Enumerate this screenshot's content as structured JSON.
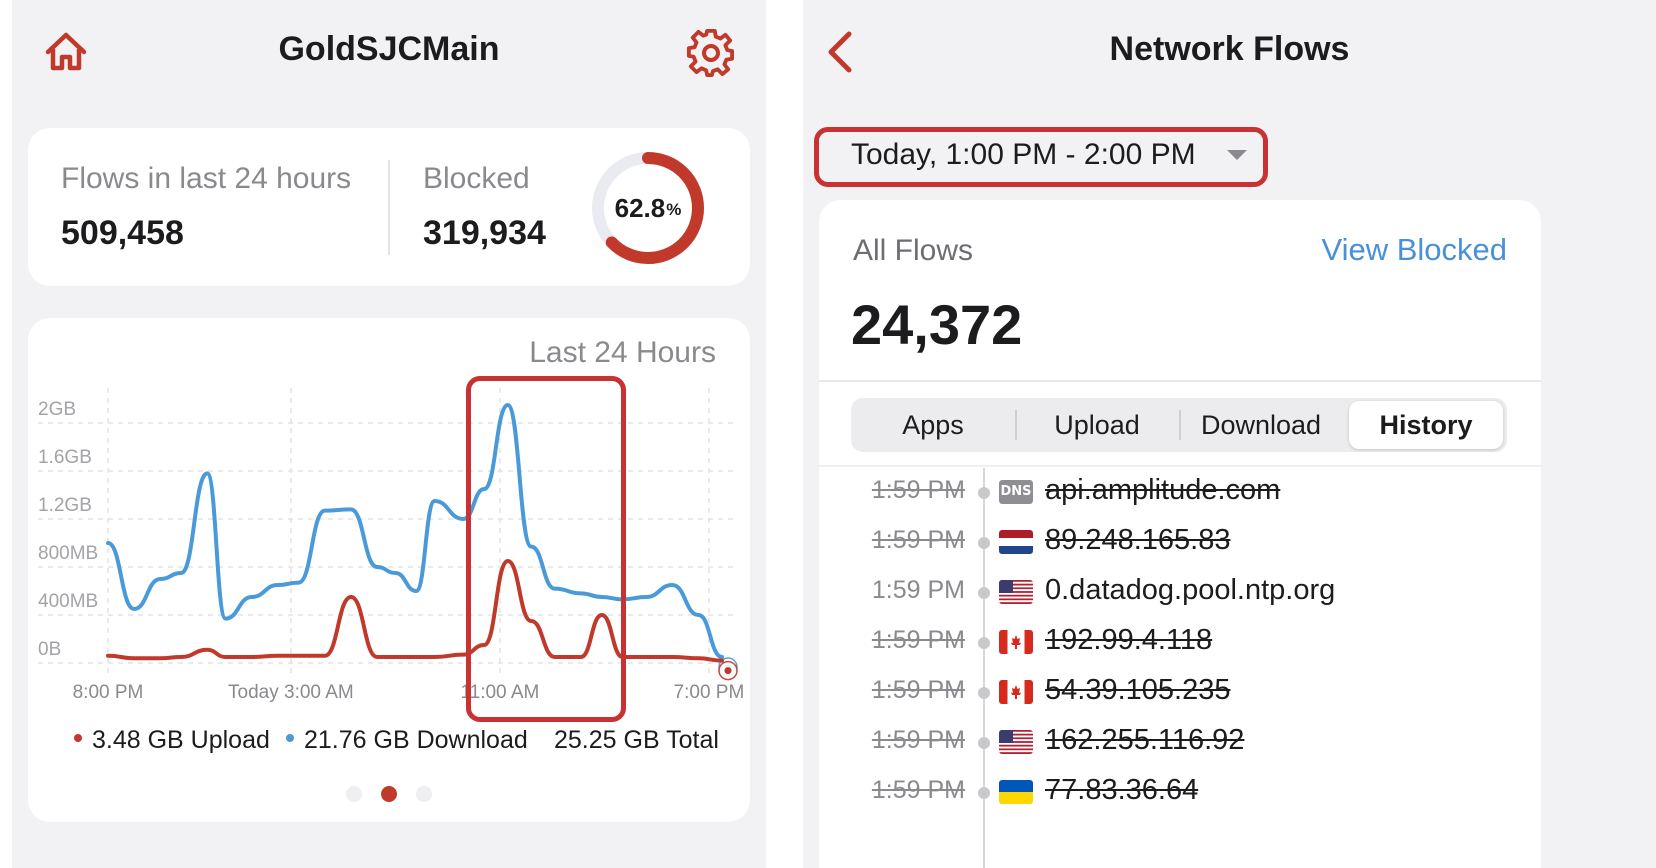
{
  "left": {
    "header": {
      "title": "GoldSJCMain",
      "home_icon": "home-icon",
      "settings_icon": "gear-icon"
    },
    "stats": {
      "flows_label": "Flows in last 24 hours",
      "flows_value": "509,458",
      "blocked_label": "Blocked",
      "blocked_value": "319,934",
      "blocked_percent": "62.8",
      "percent_sign": "%",
      "blocked_fraction": 0.628
    },
    "chart_title": "Last 24 Hours",
    "legend": {
      "upload": "3.48 GB Upload",
      "download": "21.76 GB Download",
      "total": "25.25 GB Total"
    },
    "pager": {
      "count": 3,
      "active_index": 1
    }
  },
  "right": {
    "header": {
      "title": "Network Flows",
      "back_icon": "chevron-left-icon"
    },
    "time_range": "Today, 1:00 PM - 2:00 PM",
    "all_flows_label": "All Flows",
    "view_blocked_label": "View Blocked",
    "all_flows_count": "24,372",
    "tabs": [
      "Apps",
      "Upload",
      "Download",
      "History"
    ],
    "selected_tab": "History",
    "flows": [
      {
        "time": "1:59 PM",
        "host": "api.amplitude.com",
        "icon": "dns-badge",
        "icon_text": "DNS",
        "blocked": true
      },
      {
        "time": "1:59 PM",
        "host": "89.248.165.83",
        "icon": "flag-netherlands",
        "blocked": true
      },
      {
        "time": "1:59 PM",
        "host": "0.datadog.pool.ntp.org",
        "icon": "flag-usa",
        "blocked": false
      },
      {
        "time": "1:59 PM",
        "host": "192.99.4.118",
        "icon": "flag-canada",
        "blocked": true
      },
      {
        "time": "1:59 PM",
        "host": "54.39.105.235",
        "icon": "flag-canada",
        "blocked": true
      },
      {
        "time": "1:59 PM",
        "host": "162.255.116.92",
        "icon": "flag-usa",
        "blocked": true
      },
      {
        "time": "1:59 PM",
        "host": "77.83.36.64",
        "icon": "flag-ukraine",
        "blocked": true
      }
    ]
  },
  "colors": {
    "accent_red": "#c0392b",
    "download_blue": "#4a9ad9",
    "highlight_red": "#c83232",
    "link_blue": "#4a90d9"
  },
  "chart_data": {
    "type": "line",
    "title": "Last 24 Hours",
    "y_tick_labels": [
      "0B",
      "400MB",
      "800MB",
      "1.2GB",
      "1.6GB",
      "2GB"
    ],
    "y_ticks_gb": [
      0,
      0.4,
      0.8,
      1.2,
      1.6,
      2.0
    ],
    "x_tick_labels": [
      "8:00 PM",
      "Today 3:00 AM",
      "11:00 AM",
      "7:00 PM"
    ],
    "x_tick_hours": [
      0,
      7,
      15,
      23
    ],
    "ylim": [
      0,
      2.0
    ],
    "xlim": [
      0,
      23.5
    ],
    "grid": true,
    "series": [
      {
        "name": "Download",
        "color": "#4a9ad9",
        "x": [
          0,
          1,
          2,
          2.8,
          3.8,
          4.5,
          5.5,
          6.5,
          7.3,
          8.3,
          9.3,
          10.3,
          11,
          11.8,
          12.5,
          13.6,
          14.4,
          15.3,
          16.2,
          17.1,
          18.1,
          18.9,
          19.7,
          20.6,
          21.6,
          22.6,
          23.5
        ],
        "y": [
          1.0,
          0.45,
          0.7,
          0.75,
          1.58,
          0.37,
          0.55,
          0.65,
          0.67,
          1.27,
          1.28,
          0.8,
          0.75,
          0.6,
          1.35,
          1.2,
          1.45,
          2.15,
          0.97,
          0.62,
          0.58,
          0.55,
          0.53,
          0.55,
          0.65,
          0.4,
          0.05
        ],
        "end_marker": true
      },
      {
        "name": "Upload",
        "color": "#c0392b",
        "x": [
          0,
          1,
          2,
          2.8,
          3.8,
          4.5,
          5.5,
          6.5,
          7.3,
          8.3,
          9.3,
          10.3,
          11,
          11.8,
          12.5,
          13.6,
          14.4,
          15.3,
          16.2,
          17.1,
          18.1,
          18.9,
          19.7,
          20.6,
          21.6,
          22.6,
          23.5
        ],
        "y": [
          0.06,
          0.04,
          0.04,
          0.05,
          0.11,
          0.05,
          0.05,
          0.06,
          0.06,
          0.06,
          0.55,
          0.05,
          0.05,
          0.05,
          0.05,
          0.07,
          0.15,
          0.85,
          0.35,
          0.05,
          0.05,
          0.4,
          0.05,
          0.05,
          0.05,
          0.04,
          0.02
        ],
        "end_marker": true
      }
    ]
  }
}
